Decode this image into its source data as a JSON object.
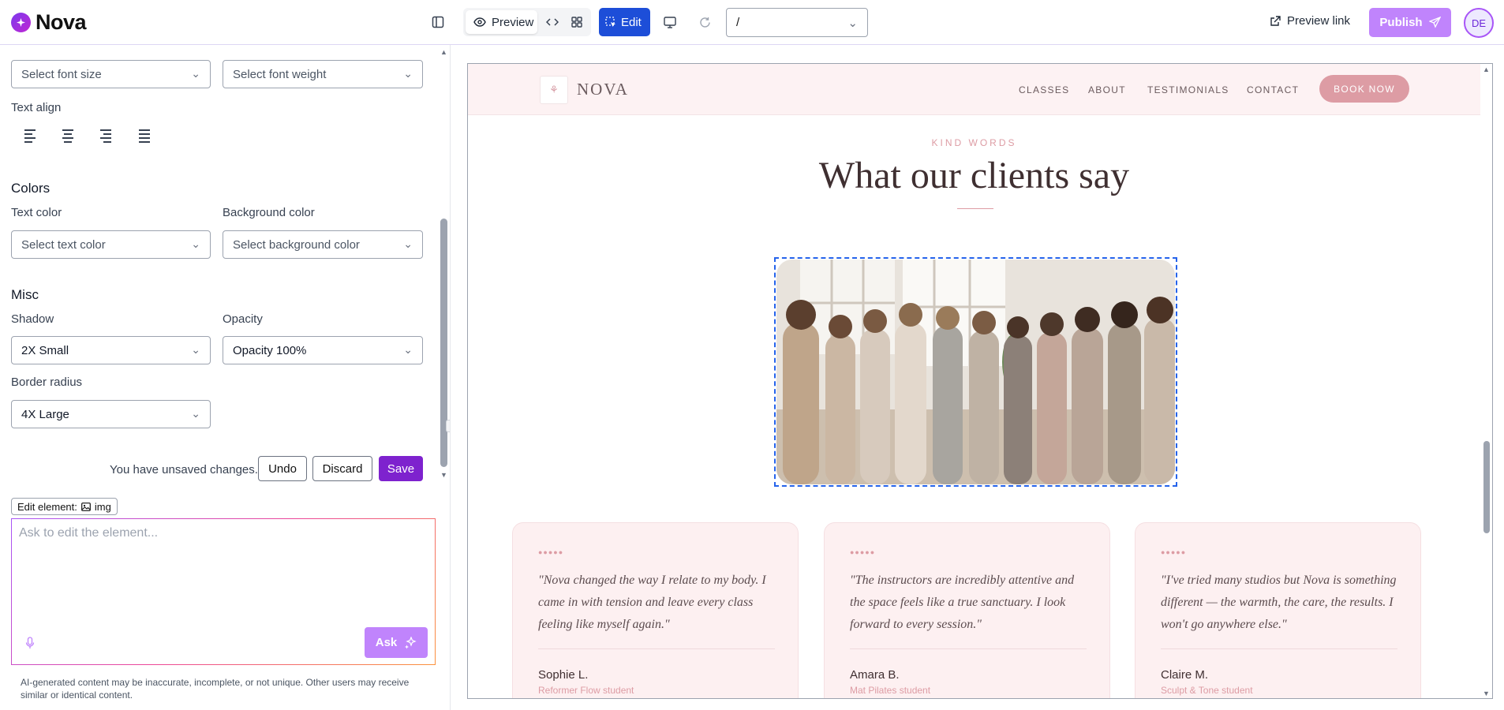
{
  "app": {
    "name": "Nova"
  },
  "toolbar": {
    "preview_label": "Preview",
    "edit_label": "Edit",
    "path_value": "/",
    "preview_link_label": "Preview link",
    "publish_label": "Publish",
    "avatar_initials": "DE"
  },
  "panel": {
    "font_size_placeholder": "Select font size",
    "font_weight_placeholder": "Select font weight",
    "text_align_label": "Text align",
    "colors_heading": "Colors",
    "text_color_label": "Text color",
    "text_color_placeholder": "Select text color",
    "bg_color_label": "Background color",
    "bg_color_placeholder": "Select background color",
    "misc_heading": "Misc",
    "shadow_label": "Shadow",
    "shadow_value": "2X Small",
    "opacity_label": "Opacity",
    "opacity_value": "Opacity 100%",
    "radius_label": "Border radius",
    "radius_value": "4X Large",
    "unsaved_text": "You have unsaved changes.",
    "undo_label": "Undo",
    "discard_label": "Discard",
    "save_label": "Save",
    "edit_element_label": "Edit element:",
    "edit_element_tag": "img",
    "ask_placeholder": "Ask to edit the element...",
    "ask_label": "Ask",
    "disclaimer": "AI-generated content may be inaccurate, incomplete, or not unique. Other users may receive similar or identical content."
  },
  "site": {
    "brand": "NOVA",
    "nav": [
      "CLASSES",
      "ABOUT",
      "TESTIMONIALS",
      "CONTACT"
    ],
    "cta": "BOOK NOW",
    "kicker": "KIND WORDS",
    "title": "What our clients say",
    "rating_dots": "●●●●●",
    "testimonials": [
      {
        "quote": "\"Nova changed the way I relate to my body. I came in with tension and leave every class feeling like myself again.\"",
        "name": "Sophie L.",
        "role": "Reformer Flow student"
      },
      {
        "quote": "\"The instructors are incredibly attentive and the space feels like a true sanctuary. I look forward to every session.\"",
        "name": "Amara B.",
        "role": "Mat Pilates student"
      },
      {
        "quote": "\"I've tried many studios but Nova is something different — the warmth, the care, the results. I won't go anywhere else.\"",
        "name": "Claire M.",
        "role": "Sculpt & Tone student"
      }
    ]
  },
  "colors": {
    "accent": "#7e22ce",
    "edit_blue": "#1d4ed8",
    "publish": "#c084fc",
    "site_pink": "#dd9ca4",
    "nav_bg": "#fdf2f3"
  }
}
